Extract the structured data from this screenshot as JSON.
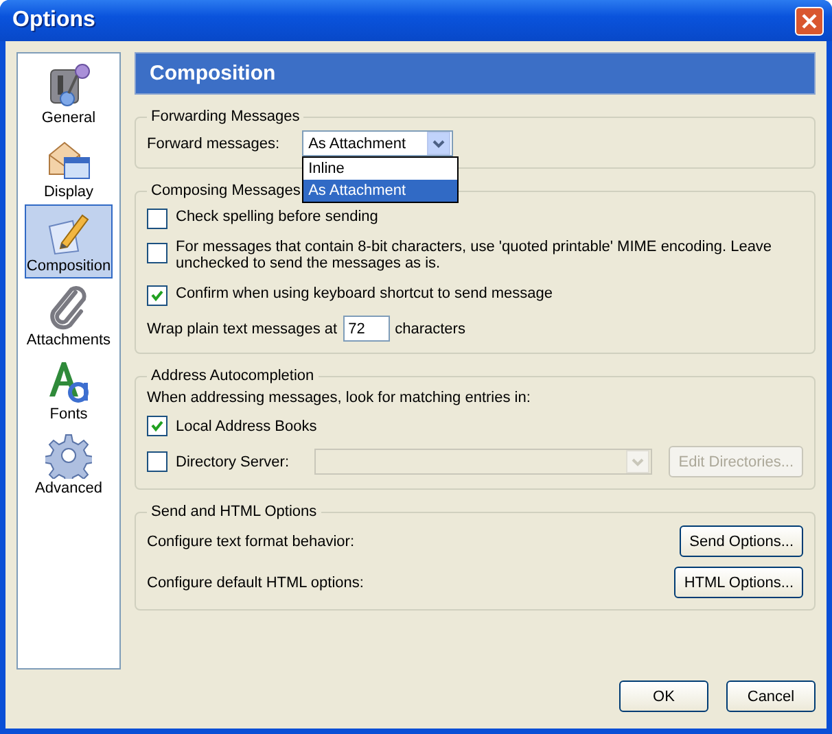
{
  "window": {
    "title": "Options"
  },
  "sidebar": {
    "items": [
      {
        "label": "General",
        "selected": false
      },
      {
        "label": "Display",
        "selected": false
      },
      {
        "label": "Composition",
        "selected": true
      },
      {
        "label": "Attachments",
        "selected": false
      },
      {
        "label": "Fonts",
        "selected": false
      },
      {
        "label": "Advanced",
        "selected": false
      }
    ]
  },
  "panel": {
    "title": "Composition"
  },
  "forwarding": {
    "title": "Forwarding Messages",
    "label": "Forward messages:",
    "value": "As Attachment",
    "expanded": true,
    "options": [
      {
        "label": "Inline",
        "selected": false
      },
      {
        "label": "As Attachment",
        "selected": true
      }
    ]
  },
  "composing": {
    "title": "Composing Messages",
    "checks": [
      {
        "label": "Check spelling before sending",
        "checked": false
      },
      {
        "label": "For messages that contain 8-bit characters, use 'quoted printable' MIME encoding. Leave unchecked to send the messages as is.",
        "checked": false
      },
      {
        "label": "Confirm when using keyboard shortcut to send message",
        "checked": true
      }
    ],
    "wrap": {
      "label": "Wrap plain text messages at",
      "value": "72",
      "suffix": "characters"
    }
  },
  "autocompletion": {
    "title": "Address Autocompletion",
    "prompt": "When addressing messages, look for matching entries in:",
    "local": {
      "label": "Local Address Books",
      "checked": true
    },
    "directory": {
      "label": "Directory Server:",
      "checked": false,
      "disabled": true
    },
    "edit_button": {
      "label": "Edit Directories...",
      "disabled": true
    }
  },
  "send_html": {
    "title": "Send and HTML Options",
    "rows": [
      {
        "label": "Configure text format behavior:",
        "button": "Send Options..."
      },
      {
        "label": "Configure default HTML options:",
        "button": "HTML Options..."
      }
    ]
  },
  "buttons": [
    "OK",
    "Cancel"
  ]
}
